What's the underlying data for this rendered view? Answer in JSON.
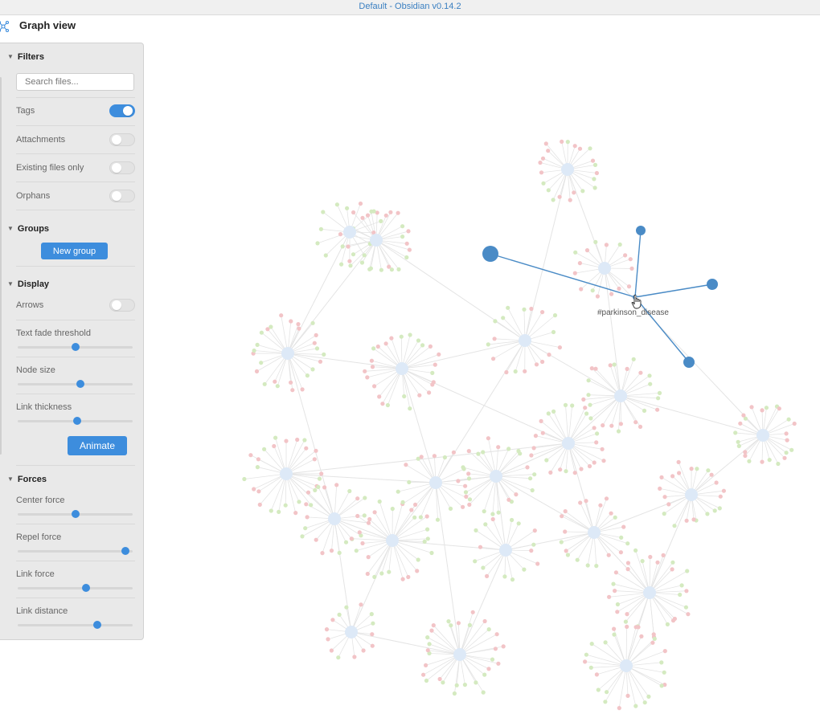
{
  "window": {
    "title": "Default - Obsidian v0.14.2"
  },
  "view": {
    "title": "Graph view",
    "icon": "graph-icon"
  },
  "filters": {
    "heading": "Filters",
    "search_placeholder": "Search files...",
    "tags": {
      "label": "Tags",
      "on": true
    },
    "attachments": {
      "label": "Attachments",
      "on": false
    },
    "existing_files_only": {
      "label": "Existing files only",
      "on": false
    },
    "orphans": {
      "label": "Orphans",
      "on": false
    }
  },
  "groups": {
    "heading": "Groups",
    "new_group_label": "New group"
  },
  "display": {
    "heading": "Display",
    "arrows": {
      "label": "Arrows",
      "on": false
    },
    "text_fade_threshold": {
      "label": "Text fade threshold",
      "value": 0.5
    },
    "node_size": {
      "label": "Node size",
      "value": 0.55
    },
    "link_thickness": {
      "label": "Link thickness",
      "value": 0.52
    },
    "animate_label": "Animate"
  },
  "forces": {
    "heading": "Forces",
    "center_force": {
      "label": "Center force",
      "value": 0.5
    },
    "repel_force": {
      "label": "Repel force",
      "value": 0.95
    },
    "link_force": {
      "label": "Link force",
      "value": 0.6
    },
    "link_distance": {
      "label": "Link distance",
      "value": 0.7
    }
  },
  "graph": {
    "hovered_label": "#parkinson_disease",
    "colors": {
      "highlight": "#4a8bc6",
      "hub": "#dde9f7",
      "leaf_red": "#f2c4c7",
      "leaf_green": "#d4eac0",
      "link": "#e4e4e4"
    }
  }
}
